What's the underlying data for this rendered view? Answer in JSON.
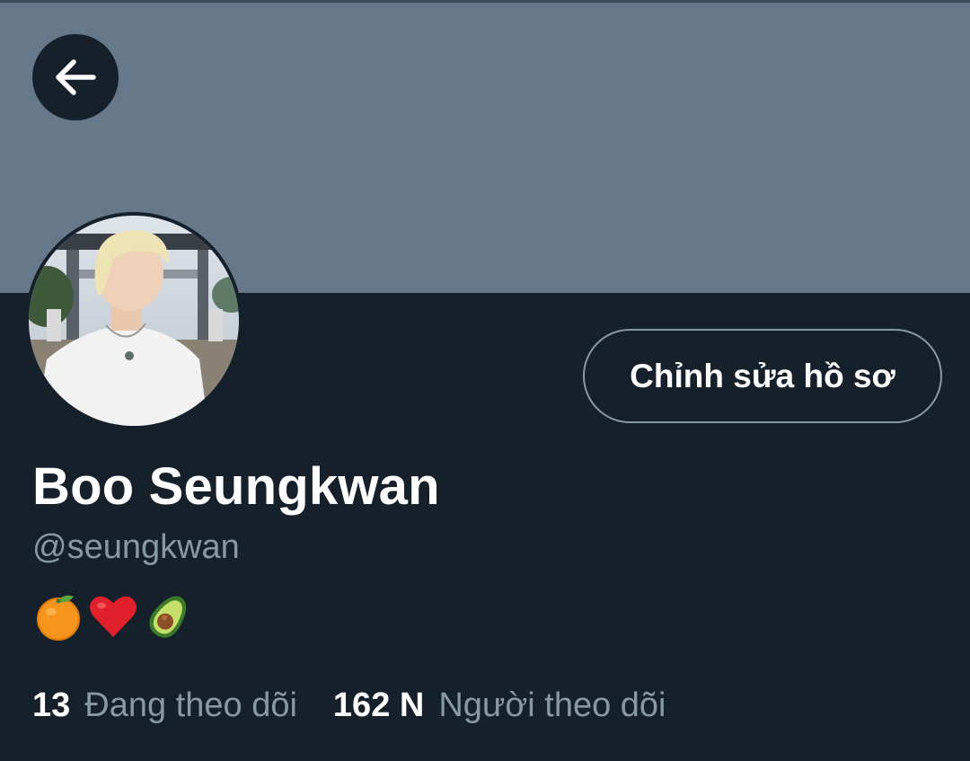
{
  "profile": {
    "display_name": "Boo Seungkwan",
    "handle": "@seungkwan",
    "bio_emojis": [
      "tangerine-emoji",
      "red-heart-emoji",
      "avocado-emoji"
    ]
  },
  "actions": {
    "edit_profile_label": "Chỉnh sửa hồ sơ"
  },
  "stats": {
    "following": {
      "count": "13",
      "label": "Đang theo dõi"
    },
    "followers": {
      "count": "162 N",
      "label": "Người theo dõi"
    }
  },
  "colors": {
    "background": "#15202b",
    "banner": "#66788a",
    "secondary_text": "#8899a6",
    "primary_text": "#ffffff"
  }
}
